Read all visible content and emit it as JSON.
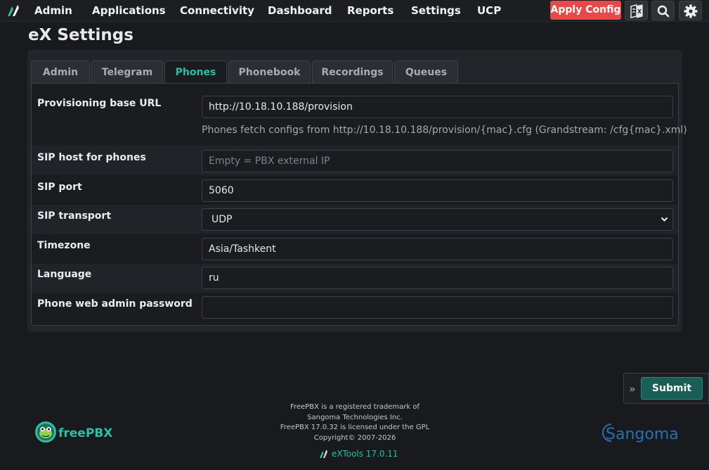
{
  "nav": {
    "items": [
      "Admin",
      "Applications",
      "Connectivity",
      "Dashboard",
      "Reports",
      "Settings",
      "UCP"
    ],
    "apply_label": "Apply Config"
  },
  "page": {
    "title": "eX Settings"
  },
  "tabs": [
    "Admin",
    "Telegram",
    "Phones",
    "Phonebook",
    "Recordings",
    "Queues"
  ],
  "active_tab": "Phones",
  "form": {
    "provisioning_label": "Provisioning base URL",
    "provisioning_value": "http://10.18.10.188/provision",
    "provisioning_help": "Phones fetch configs from http://10.18.10.188/provision/{mac}.cfg (Grandstream: /cfg{mac}.xml)",
    "sip_host_label": "SIP host for phones",
    "sip_host_placeholder": "Empty = PBX external IP",
    "sip_port_label": "SIP port",
    "sip_port_value": "5060",
    "sip_transport_label": "SIP transport",
    "sip_transport_value": "UDP",
    "timezone_label": "Timezone",
    "timezone_value": "Asia/Tashkent",
    "language_label": "Language",
    "language_value": "ru",
    "password_label": "Phone web admin password",
    "password_value": ""
  },
  "actions": {
    "submit_label": "Submit"
  },
  "footer": {
    "line1": "FreePBX is a registered trademark of",
    "line2": "Sangoma Technologies Inc.",
    "line3": "FreePBX 17.0.32 is licensed under the GPL",
    "line4": "Copyright© 2007-2026",
    "extools": "eXTools 17.0.11",
    "freepbx_logo": "freePBX",
    "sangoma_logo": "Sangoma"
  },
  "colors": {
    "accent": "#2bbfa4",
    "apply": "#e84848",
    "submit": "#1b5e57"
  }
}
